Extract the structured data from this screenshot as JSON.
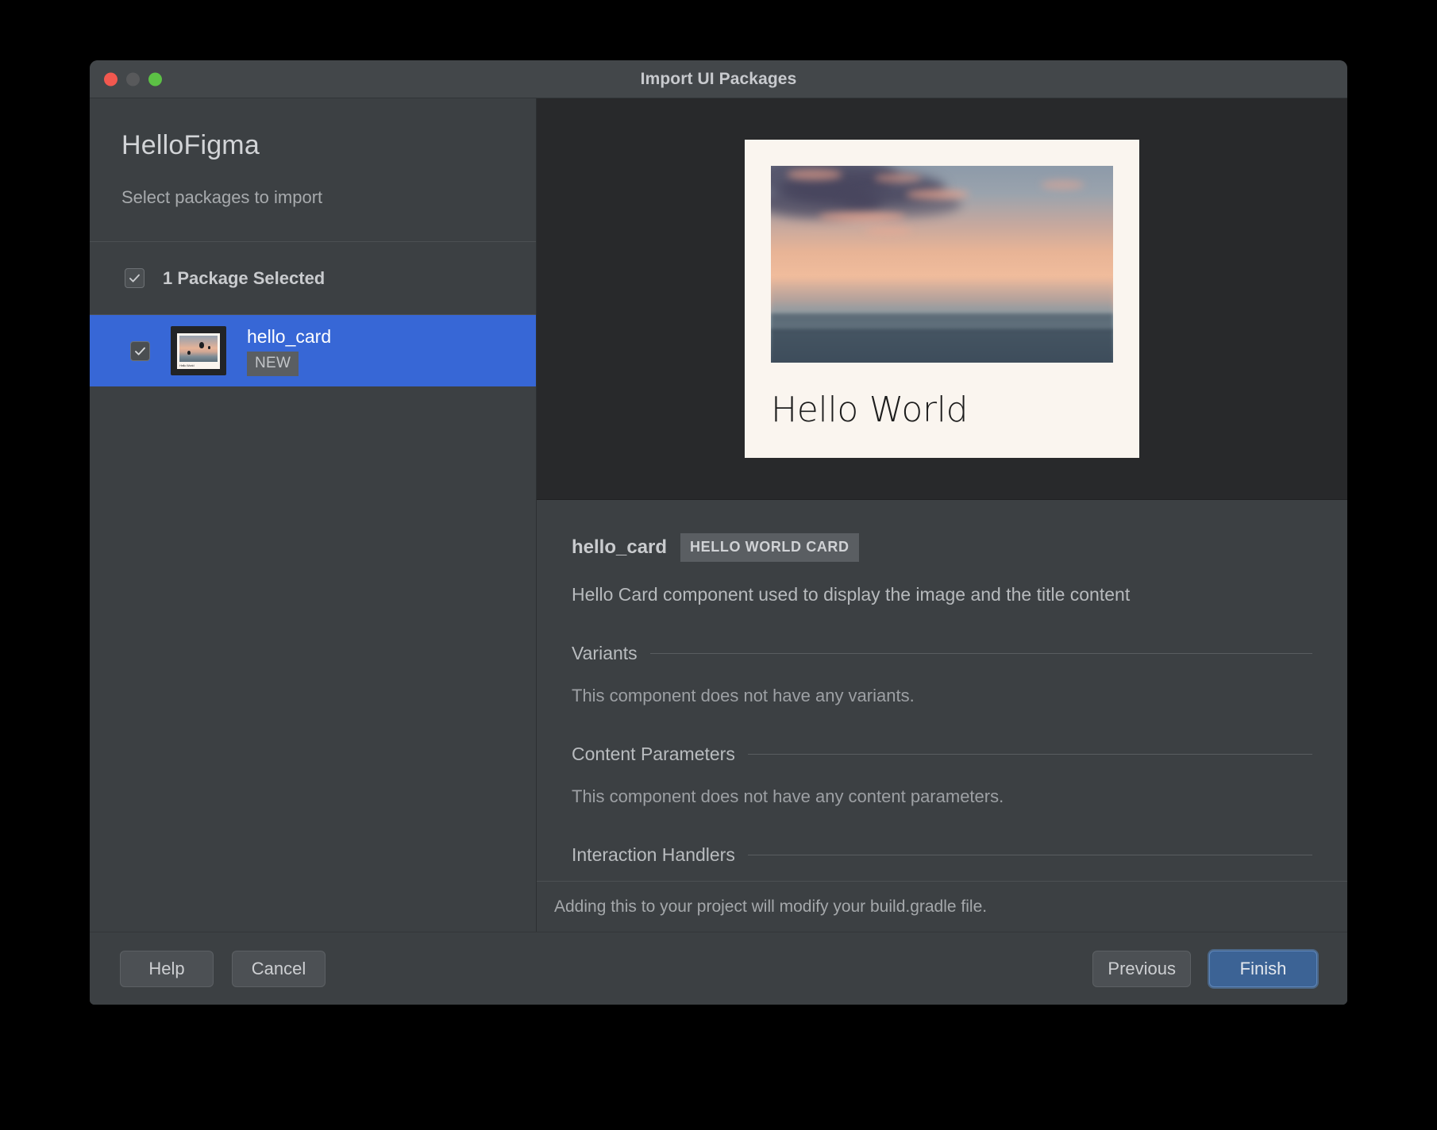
{
  "window": {
    "title": "Import UI Packages",
    "traffic_lights": [
      "close-button",
      "minimize-button",
      "maximize-button"
    ]
  },
  "sidebar": {
    "project_title": "HelloFigma",
    "subtitle": "Select packages to import",
    "select_all": {
      "label": "1 Package Selected",
      "checked": true
    },
    "packages": [
      {
        "name": "hello_card",
        "badge": "NEW",
        "checked": true,
        "selected": true,
        "thumbnail_caption": "Hello World"
      }
    ]
  },
  "preview": {
    "card": {
      "title": "Hello World",
      "image_alt": "hot-air-balloons-at-sunset"
    }
  },
  "details": {
    "name": "hello_card",
    "tag": "HELLO WORLD CARD",
    "description": "Hello Card component used to display the image and the title content",
    "sections": [
      {
        "title": "Variants",
        "body": "This component does not have any variants."
      },
      {
        "title": "Content Parameters",
        "body": "This component does not have any content parameters."
      },
      {
        "title": "Interaction Handlers",
        "body": ""
      }
    ]
  },
  "notice": "Adding this to your project will modify your build.gradle file.",
  "buttons": {
    "help": "Help",
    "cancel": "Cancel",
    "previous": "Previous",
    "finish": "Finish"
  },
  "colors": {
    "window_bg": "#3c4043",
    "titlebar_bg": "#43474a",
    "preview_bg": "#28292b",
    "selection_blue": "#3767d6",
    "primary_button": "#3c6395",
    "card_bg": "#faf5ef",
    "traffic_close": "#f2584f",
    "traffic_min": "#58595b",
    "traffic_max": "#5cc145"
  }
}
